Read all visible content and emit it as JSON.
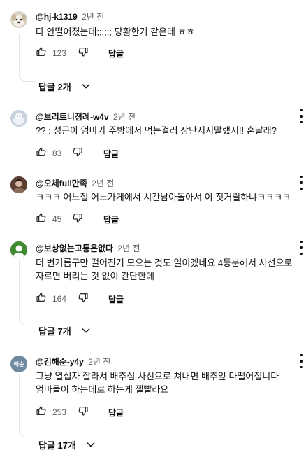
{
  "comments": [
    {
      "handle": "@hj-k1319",
      "time": "2년 전",
      "lines": [
        "다 안떨어졌는데;;;;;; 당황한거 같은데 ㅎㅎ"
      ],
      "likes": "123",
      "reply_label": "답글",
      "replies_label": "답글 2개",
      "avatar": {
        "icon": "dog-avatar-icon",
        "color": "#e9e4dc"
      }
    },
    {
      "handle": "@브리트니점례-w4v",
      "time": "2년 전",
      "lines": [
        "?? : 성근아 엄마가 주방에서 먹는걸러 장난지지말랬지!! 혼날래?"
      ],
      "likes": "83",
      "reply_label": "답글",
      "avatar": {
        "icon": "bird-avatar-icon",
        "color": "#b9c7d6"
      }
    },
    {
      "handle": "@오체full만족",
      "time": "2년 전",
      "lines": [
        "ㅋㅋㅋ 어느집 어느가게에서 시간남아돌아서 이 짓거릴하냐ㅋㅋㅋㅋ"
      ],
      "likes": "45",
      "reply_label": "답글",
      "avatar": {
        "icon": "person-avatar-icon",
        "color": "#6b4a3a"
      }
    },
    {
      "handle": "@보상없는고통은없다",
      "time": "2년 전",
      "lines": [
        "더 번거롭구만 떨어진거 모으는 것도 일이겠네요 4등분해서 사선으로",
        "자르면 버리는 것 없이 간단한데"
      ],
      "likes": "164",
      "reply_label": "답글",
      "replies_label": "답글 7개",
      "avatar": {
        "icon": "green-avatar-icon",
        "color": "#4a8a3a"
      }
    },
    {
      "handle": "@김해순-y4y",
      "time": "2년 전",
      "lines": [
        "그냥 열십자 잘라서 배추심 사선으로 쳐내면 배추잎 다떨어집니다",
        "엄마들이 하는데로 하는게 젤빨라요"
      ],
      "likes": "253",
      "reply_label": "답글",
      "replies_label": "답글 17개",
      "avatar": {
        "icon": "initials-avatar",
        "text": "해순",
        "color": "#6e8aa0"
      }
    }
  ]
}
